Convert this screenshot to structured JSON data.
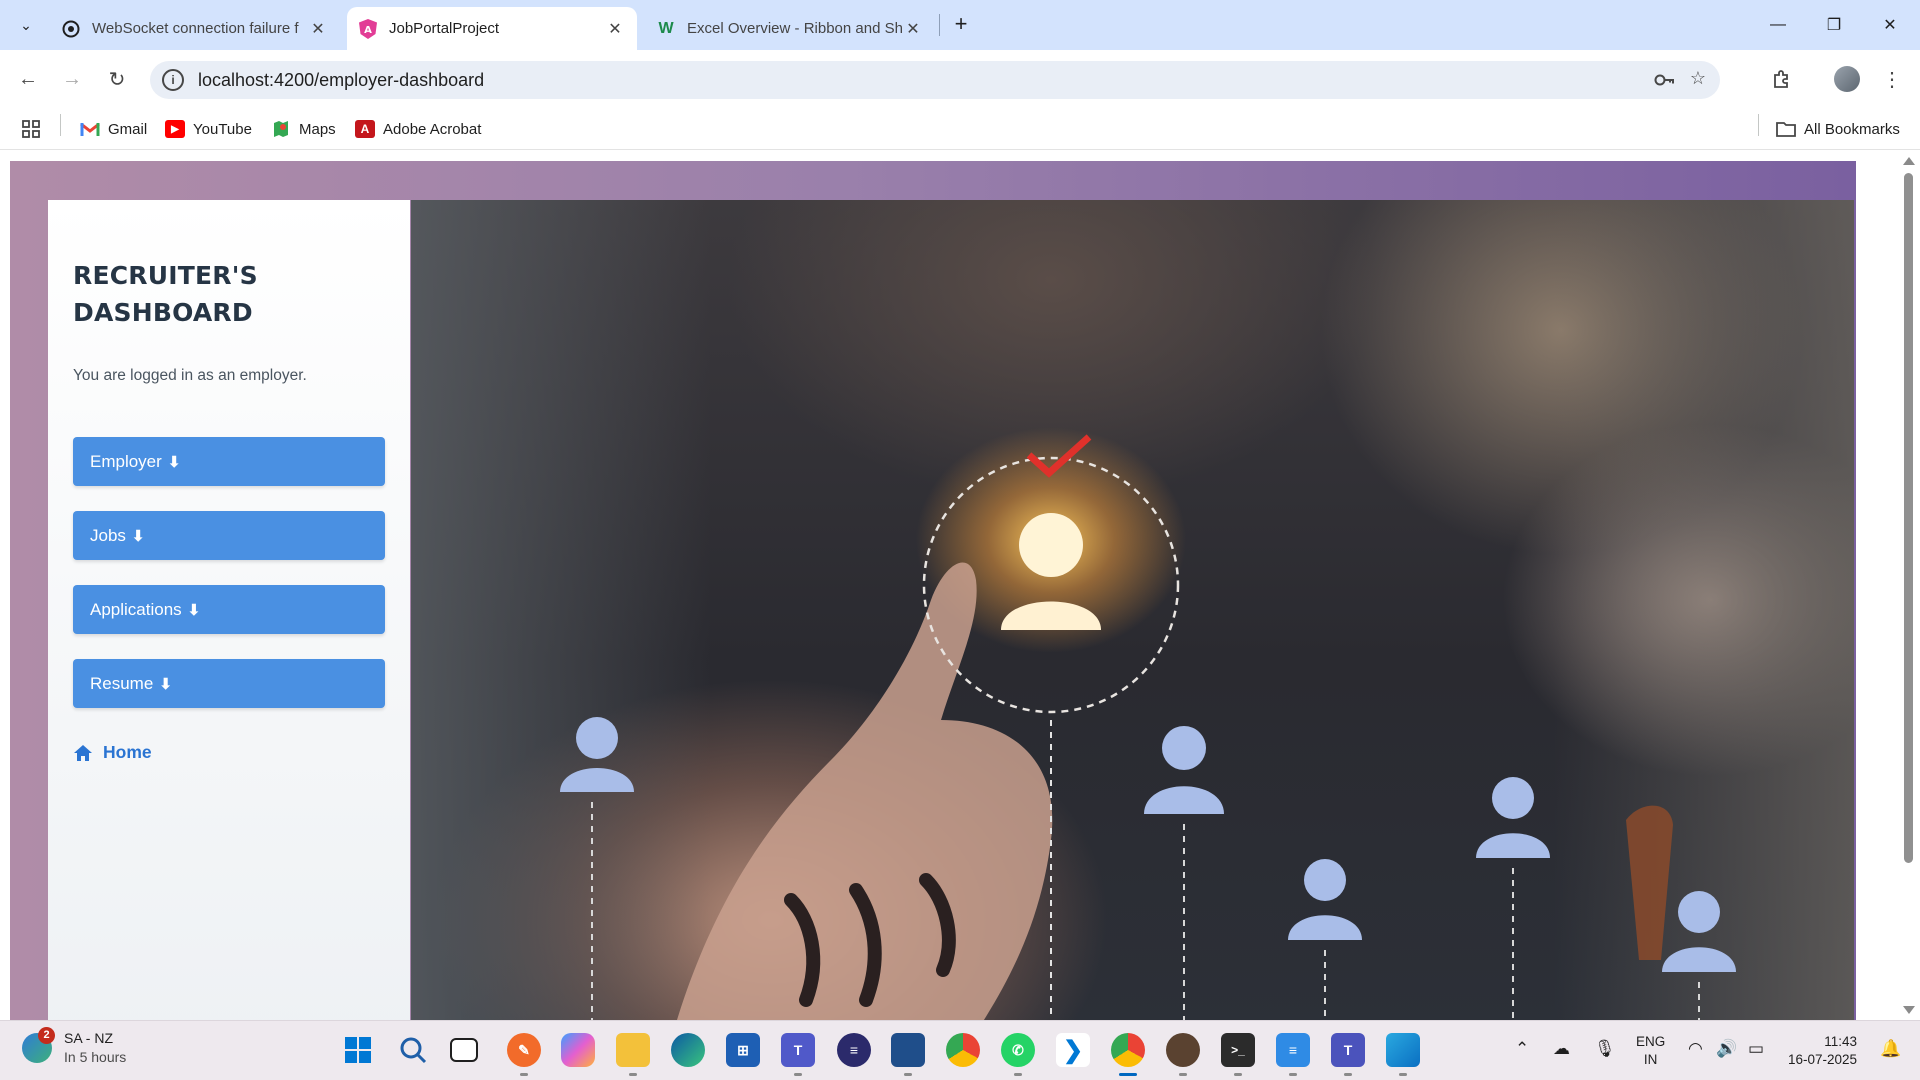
{
  "browser": {
    "tabs": [
      {
        "title": "WebSocket connection failure f",
        "favicon": "chatgpt-icon",
        "active": false
      },
      {
        "title": "JobPortalProject",
        "favicon": "angular-icon",
        "active": true
      },
      {
        "title": "Excel Overview - Ribbon and Sh",
        "favicon": "w-icon",
        "active": false
      }
    ],
    "url": "localhost:4200/employer-dashboard",
    "bookmarks": [
      {
        "label": "Gmail",
        "icon": "gmail-icon"
      },
      {
        "label": "YouTube",
        "icon": "youtube-icon"
      },
      {
        "label": "Maps",
        "icon": "maps-icon"
      },
      {
        "label": "Adobe Acrobat",
        "icon": "acrobat-icon"
      }
    ],
    "all_bookmarks": "All Bookmarks"
  },
  "sidebar": {
    "title_line1": "RECRUITER'S",
    "title_line2": "DASHBOARD",
    "subtitle": "You are logged in as an employer.",
    "buttons": [
      {
        "label": "Employer",
        "arrow": "⬇"
      },
      {
        "label": "Jobs",
        "arrow": "⬇"
      },
      {
        "label": "Applications",
        "arrow": "⬇"
      },
      {
        "label": "Resume",
        "arrow": "⬇"
      }
    ],
    "home_label": "Home"
  },
  "taskbar": {
    "weather": {
      "location": "SA - NZ",
      "detail": "In 5 hours",
      "badge": "2"
    },
    "language_line1": "ENG",
    "language_line2": "IN",
    "time": "11:43",
    "date": "16-07-2025"
  },
  "colors": {
    "accent_button": "#4a90e2",
    "home_link": "#2a74d2",
    "title": "#263545",
    "page_gradient_left": "#b08ca8",
    "page_gradient_right": "#7a60a0"
  }
}
